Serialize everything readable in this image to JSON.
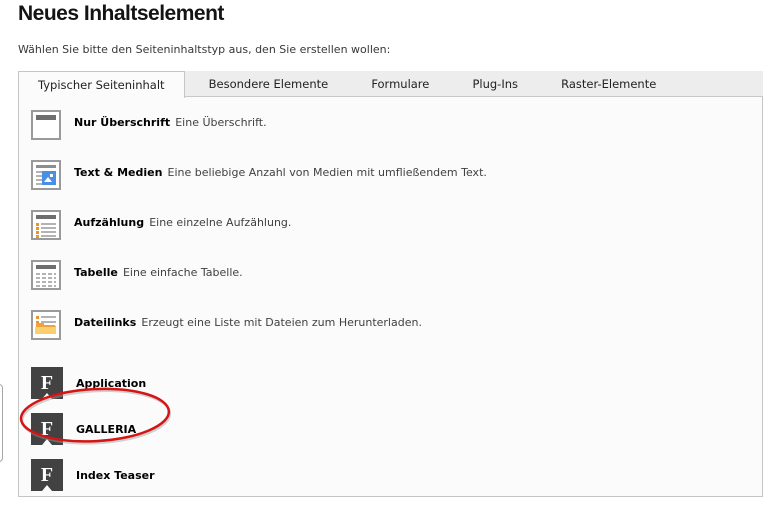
{
  "page": {
    "title": "Neues Inhaltselement",
    "subtitle": "Wählen Sie bitte den Seiteninhaltstyp aus, den Sie erstellen wollen:"
  },
  "tabs": [
    {
      "label": "Typischer Seiteninhalt",
      "active": true
    },
    {
      "label": "Besondere Elemente",
      "active": false
    },
    {
      "label": "Formulare",
      "active": false
    },
    {
      "label": "Plug-Ins",
      "active": false
    },
    {
      "label": "Raster-Elemente",
      "active": false
    }
  ],
  "items": [
    {
      "title": "Nur Überschrift",
      "description": "Eine Überschrift.",
      "icon": "header-only-icon"
    },
    {
      "title": "Text & Medien",
      "description": "Eine beliebige Anzahl von Medien mit umfließendem Text.",
      "icon": "text-media-icon"
    },
    {
      "title": "Aufzählung",
      "description": "Eine einzelne Aufzählung.",
      "icon": "bullet-list-icon"
    },
    {
      "title": "Tabelle",
      "description": "Eine einfache Tabelle.",
      "icon": "table-icon"
    },
    {
      "title": "Dateilinks",
      "description": "Erzeugt eine Liste mit Dateien zum Herunterladen.",
      "icon": "filelinks-icon"
    },
    {
      "title": "Application",
      "description": "",
      "icon": "plugin-f-icon"
    },
    {
      "title": "GALLERIA",
      "description": "",
      "icon": "plugin-f-icon",
      "highlighted": true
    },
    {
      "title": "Index Teaser",
      "description": "",
      "icon": "plugin-f-icon"
    }
  ],
  "icons": {
    "plugin_letter": "F"
  },
  "annotation": {
    "type": "ellipse",
    "target": "GALLERIA",
    "color": "#d61414"
  },
  "colors": {
    "panel_bg": "#fbfbfb",
    "tabstrip_bg": "#ededed",
    "border": "#c5c5c5",
    "plugin_icon_bg": "#424242",
    "media_blue": "#4a90e2",
    "bullet_orange": "#e8952f",
    "folder_orange": "#f0a23a",
    "folder_light": "#fbcf6f",
    "annotation_red": "#d61414"
  }
}
